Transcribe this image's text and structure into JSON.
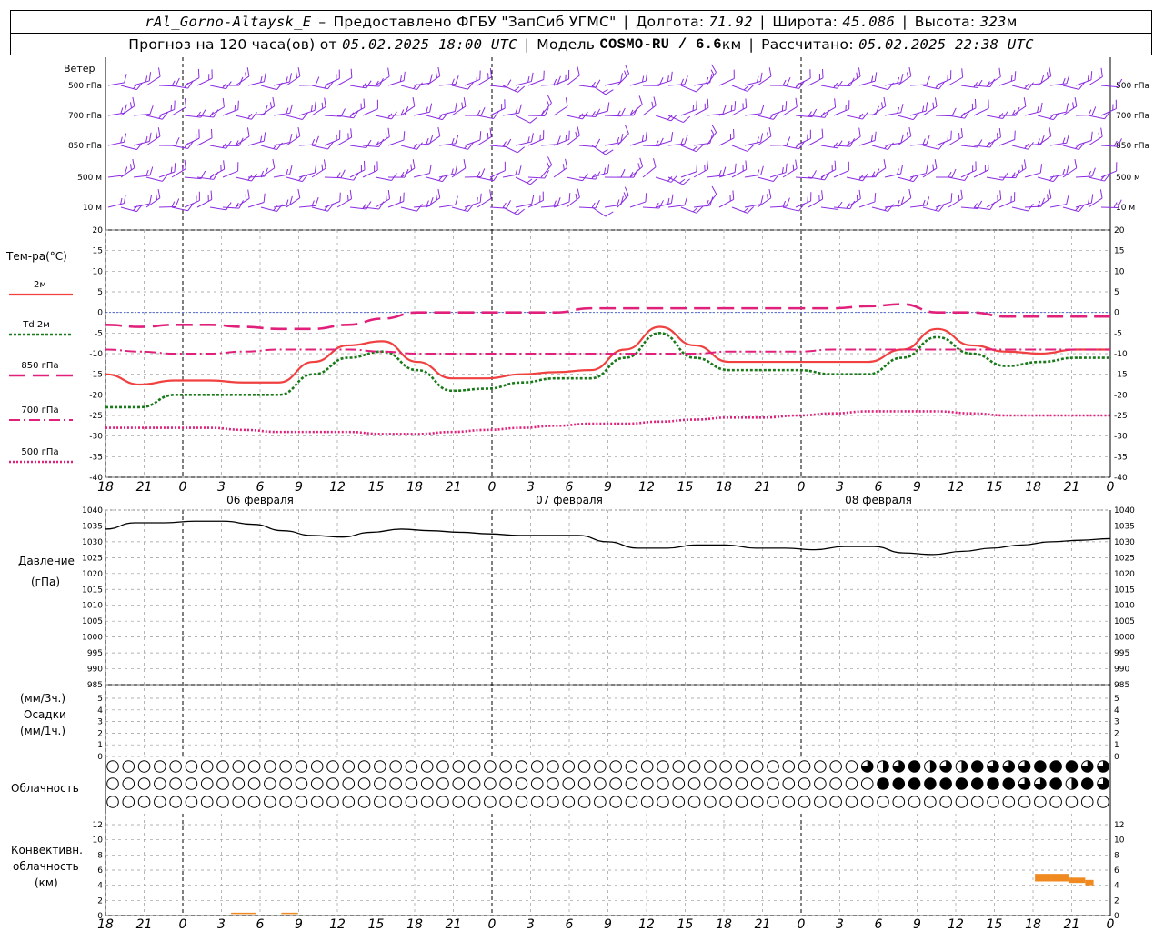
{
  "header": {
    "station": "rAl_Gorno-Altaysk_E",
    "dash": "–",
    "provider": "Предоставлено ФГБУ \"ЗапСиб УГМС\"",
    "lon_label": "Долгота:",
    "lon": "71.92",
    "lat_label": "Широта:",
    "lat": "45.086",
    "alt_label": "Высота:",
    "alt": "323",
    "alt_unit": "м",
    "forecast_label": "Прогноз на 120 часа(ов) от",
    "forecast_time": "05.02.2025 18:00 UTC",
    "model_label": "Модель",
    "model": "COSMO-RU / 6.6",
    "model_unit": "км",
    "calc_label": "Рассчитано:",
    "calc_time": "05.02.2025 22:38 UTC"
  },
  "wind_panel": {
    "title": "Ветер",
    "levels": [
      "500 гПа",
      "700 гПа",
      "850 гПа",
      "500 м",
      "10 м"
    ],
    "color": "#8b2be2"
  },
  "temp_panel": {
    "title": "Тем-ра(°C)",
    "legend": [
      {
        "label": "2м",
        "color": "#f04040",
        "style": "solid"
      },
      {
        "label": "Td  2м",
        "color": "#1a7a1a",
        "style": "dotted"
      },
      {
        "label": "850 гПа",
        "color": "#e0207a",
        "style": "longdash"
      },
      {
        "label": "700 гПа",
        "color": "#e0207a",
        "style": "dashdot"
      },
      {
        "label": "500 гПа",
        "color": "#e0207a",
        "style": "dotted"
      }
    ],
    "yticks": [
      "20",
      "15",
      "10",
      "5",
      "0",
      "-5",
      "-10",
      "-15",
      "-20",
      "-25",
      "-30",
      "-35",
      "-40"
    ]
  },
  "pressure_panel": {
    "title": "Давление",
    "unit": "(гПа)",
    "yticks": [
      "1040",
      "1035",
      "1030",
      "1025",
      "1020",
      "1015",
      "1010",
      "1005",
      "1000",
      "995",
      "990",
      "985"
    ]
  },
  "precip_panel": {
    "line1": "(мм/3ч.)",
    "line2": "Осадки",
    "line3": "(мм/1ч.)",
    "yticks": [
      "5",
      "4",
      "3",
      "2",
      "1",
      "0"
    ]
  },
  "cloud_panel": {
    "title": "Облачность"
  },
  "conv_panel": {
    "line1": "Конвективн.",
    "line2": "облачность",
    "line3": "(км)",
    "yticks": [
      "12",
      "10",
      "8",
      "6",
      "4",
      "2",
      "0"
    ]
  },
  "time_axis": {
    "hour_labels": [
      "18",
      "21",
      "0",
      "3",
      "6",
      "9",
      "12",
      "15",
      "18",
      "21",
      "0",
      "3",
      "6",
      "9",
      "12",
      "15",
      "18",
      "21",
      "0",
      "3",
      "6",
      "9",
      "12",
      "15",
      "18",
      "21",
      "0"
    ],
    "dates": [
      "06 февраля",
      "07 февраля",
      "08 февраля"
    ]
  },
  "chart_data": {
    "type": "line",
    "x_hours_from_start": [
      0,
      3,
      6,
      9,
      12,
      15,
      18,
      21,
      24,
      27,
      30,
      33,
      36,
      39,
      42,
      45,
      48,
      51,
      54,
      57,
      60,
      63,
      66,
      69,
      72,
      75,
      78
    ],
    "temperature": {
      "ylim": [
        -40,
        20
      ],
      "series": [
        {
          "name": "2м",
          "values": [
            -15,
            -17.5,
            -16.5,
            -16.5,
            -17,
            -17,
            -12,
            -8,
            -7,
            -12,
            -16,
            -16,
            -15,
            -14.5,
            -14,
            -9,
            -3.5,
            -8,
            -12,
            -12,
            -12,
            -12,
            -12,
            -9,
            -4,
            -8,
            -9.5,
            -10,
            -9,
            -9
          ]
        },
        {
          "name": "Td  2м",
          "values": [
            -23,
            -23,
            -20,
            -20,
            -20,
            -20,
            -15,
            -11,
            -9.5,
            -14,
            -19,
            -18.5,
            -17,
            -16,
            -16,
            -11,
            -5,
            -11,
            -14,
            -14,
            -14,
            -15,
            -15,
            -11,
            -6,
            -10,
            -13,
            -12,
            -11,
            -11
          ]
        },
        {
          "name": "850 гПа",
          "values": [
            -3,
            -3.5,
            -3,
            -3,
            -3.5,
            -4,
            -4,
            -3,
            -1.5,
            0,
            0,
            0,
            0,
            0,
            1,
            1,
            1,
            1,
            1,
            1,
            1,
            1,
            1.5,
            2,
            0,
            0,
            -1,
            -1,
            -1,
            -1
          ]
        },
        {
          "name": "700 гПа",
          "values": [
            -9,
            -9.5,
            -10,
            -10,
            -9.5,
            -9,
            -9,
            -9,
            -9.5,
            -10,
            -10,
            -10,
            -10,
            -10,
            -10,
            -10,
            -10,
            -10,
            -9.5,
            -9.5,
            -9.5,
            -9,
            -9,
            -9,
            -9,
            -9,
            -9,
            -9,
            -9,
            -9
          ]
        },
        {
          "name": "500 гПа",
          "values": [
            -28,
            -28,
            -28,
            -28,
            -28.5,
            -29,
            -29,
            -29,
            -29.5,
            -29.5,
            -29,
            -28.5,
            -28,
            -27.5,
            -27,
            -27,
            -26.5,
            -26,
            -25.5,
            -25.5,
            -25,
            -24.5,
            -24,
            -24,
            -24,
            -24.5,
            -25,
            -25,
            -25,
            -25
          ]
        }
      ],
      "x_step_hours": 4
    },
    "pressure": {
      "ylim": [
        985,
        1040
      ],
      "x_step_hours": 4,
      "values": [
        1034,
        1036,
        1036,
        1036.5,
        1036.5,
        1035.5,
        1033.5,
        1032,
        1031.5,
        1033,
        1034,
        1033.5,
        1033,
        1032.5,
        1032,
        1032,
        1032,
        1030,
        1028,
        1028,
        1029,
        1029,
        1028,
        1028,
        1027.5,
        1028.5,
        1028.5,
        1026.5,
        1026,
        1027,
        1028,
        1029,
        1030,
        1030.5,
        1031
      ]
    },
    "precipitation": {
      "ylim": [
        0,
        5
      ],
      "values": []
    },
    "cloud_cover": {
      "rows": 3,
      "count": 64,
      "upper": "000000000000000000000000000000000000000000000000323423243334443324443432444444",
      "middle": "000000000000000000000000000000000000000000000000044444444433424344444444444444",
      "lower": "000000000000000000000000000000000000000000000000000000000000000000000000000000"
    },
    "convective_cloud_km": {
      "ylim": [
        0,
        13
      ],
      "segments": [
        {
          "from_hour": 15,
          "to_hour": 18,
          "top": 1,
          "base": 1,
          "kind": "line"
        },
        {
          "from_hour": 21,
          "to_hour": 23,
          "top": 1,
          "base": 1,
          "kind": "line"
        },
        {
          "from_hour": 111,
          "to_hour": 113,
          "top": 5.5,
          "base": 4.5,
          "kind": "bar"
        },
        {
          "from_hour": 113,
          "to_hour": 115,
          "top": 5.5,
          "base": 4.5,
          "kind": "bar"
        },
        {
          "from_hour": 115,
          "to_hour": 117,
          "top": 5,
          "base": 4.3,
          "kind": "bar"
        },
        {
          "from_hour": 117,
          "to_hour": 118,
          "top": 4.7,
          "base": 4,
          "kind": "bar"
        }
      ]
    }
  }
}
